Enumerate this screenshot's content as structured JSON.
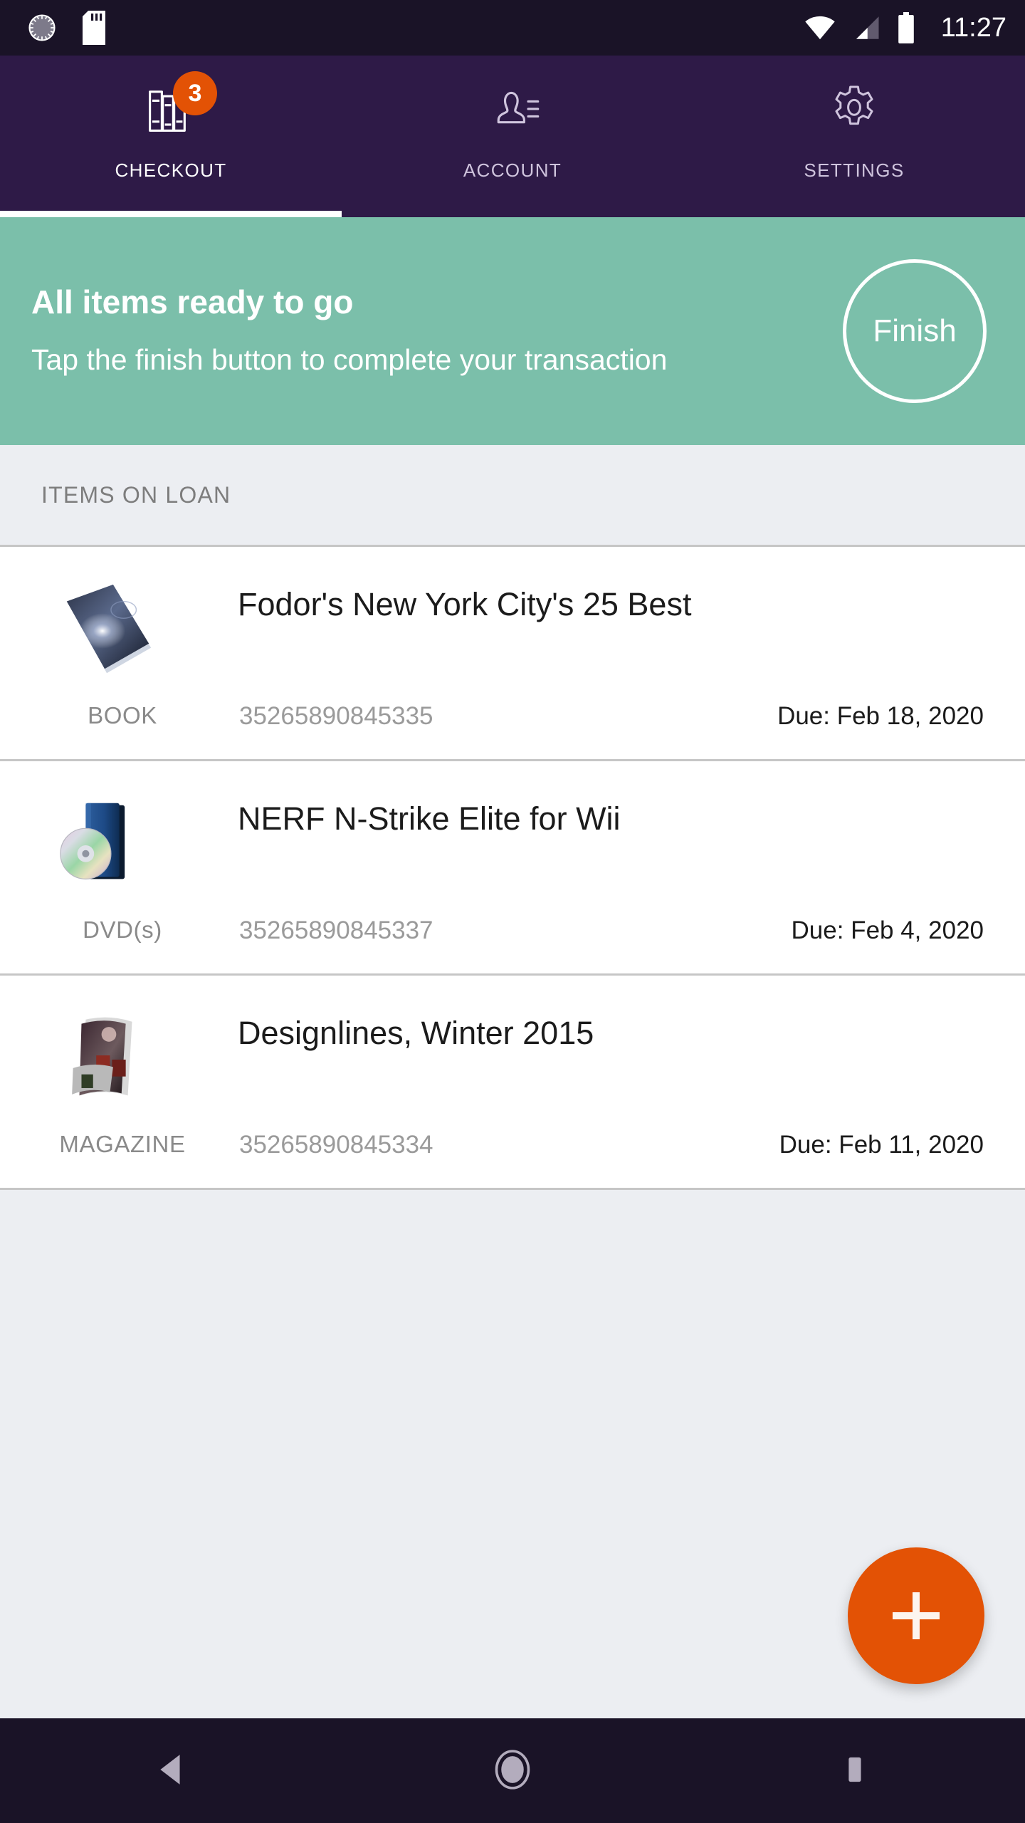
{
  "status_bar": {
    "time": "11:27",
    "icons": [
      "dial-icon",
      "sd-card-icon",
      "wifi-icon",
      "cell-signal-icon",
      "battery-icon"
    ]
  },
  "tabs": [
    {
      "label": "CHECKOUT",
      "icon": "books-icon",
      "badge": "3",
      "active": true
    },
    {
      "label": "ACCOUNT",
      "icon": "person-list-icon",
      "badge": "",
      "active": false
    },
    {
      "label": "SETTINGS",
      "icon": "gear-icon",
      "badge": "",
      "active": false
    }
  ],
  "banner": {
    "title": "All items ready to go",
    "subtitle": "Tap the finish button to complete your transaction",
    "finish_label": "Finish"
  },
  "section": {
    "header": "ITEMS ON LOAN"
  },
  "items": [
    {
      "title": "Fodor's New York City's 25 Best",
      "type": "BOOK",
      "barcode": "35265890845335",
      "due": "Due: Feb 18, 2020",
      "thumb": "book-thumbnail"
    },
    {
      "title": "NERF N-Strike Elite for Wii",
      "type": "DVD(s)",
      "barcode": "35265890845337",
      "due": "Due: Feb 4, 2020",
      "thumb": "dvd-thumbnail"
    },
    {
      "title": "Designlines, Winter 2015",
      "type": "MAGAZINE",
      "barcode": "35265890845334",
      "due": "Due: Feb 11, 2020",
      "thumb": "magazine-thumbnail"
    }
  ],
  "fab": {
    "icon": "plus-icon",
    "label": "+"
  },
  "nav_bar": {
    "back": "back-triangle-icon",
    "home": "home-circle-icon",
    "recents": "recents-square-icon"
  },
  "colors": {
    "status_bar": "#1a1327",
    "tab_bar": "#2e1a47",
    "banner": "#7bbfaa",
    "accent_orange": "#e35205",
    "page_background": "#eceef2",
    "row_background": "#ffffff",
    "divider": "#c6c6c6"
  }
}
